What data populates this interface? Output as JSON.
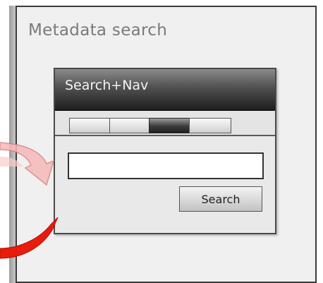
{
  "panel": {
    "title": "Metadata search"
  },
  "widget": {
    "title": "Search+Nav",
    "tabs": [
      {
        "label": "",
        "active": false
      },
      {
        "label": "",
        "active": false
      },
      {
        "label": "",
        "active": true
      },
      {
        "label": "",
        "active": false
      }
    ],
    "search_input": {
      "value": "",
      "placeholder": ""
    },
    "search_button_label": "Search"
  },
  "annotations": {
    "arrow_upper_color": "#f4a9a9",
    "arrow_lower_color": "#e81c0c"
  }
}
